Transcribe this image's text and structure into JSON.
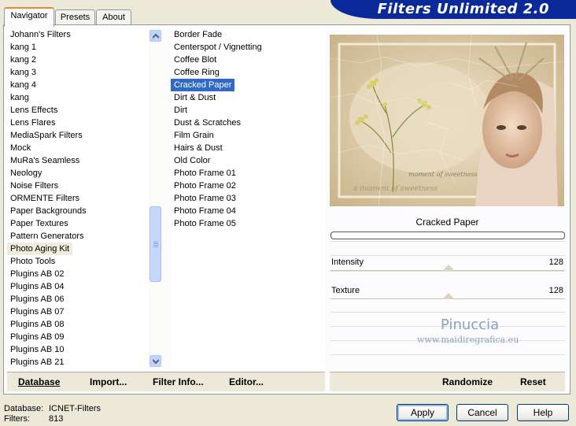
{
  "app": {
    "title": "Filters Unlimited 2.0"
  },
  "tabs": [
    {
      "label": "Navigator"
    },
    {
      "label": "Presets"
    },
    {
      "label": "About"
    }
  ],
  "categories": {
    "items": [
      "Johann's Filters",
      "kang 1",
      "kang 2",
      "kang 3",
      "kang 4",
      "kang",
      "Lens Effects",
      "Lens Flares",
      "MediaSpark Filters",
      "Mock",
      "MuRa's Seamless",
      "Neology",
      "Noise Filters",
      "ORMENTE Filters",
      "Paper Backgrounds",
      "Paper Textures",
      "Pattern Generators",
      "Photo Aging Kit",
      "Photo Tools",
      "Plugins AB 02",
      "Plugins AB 04",
      "Plugins AB 06",
      "Plugins AB 07",
      "Plugins AB 08",
      "Plugins AB 09",
      "Plugins AB 10",
      "Plugins AB 21"
    ],
    "selected": "Photo Aging Kit"
  },
  "filters": {
    "items": [
      "Border Fade",
      "Centerspot / Vignetting",
      "Coffee Blot",
      "Coffee Ring",
      "Cracked Paper",
      "Dirt & Dust",
      "Dirt",
      "Dust & Scratches",
      "Film Grain",
      "Hairs & Dust",
      "Old Color",
      "Photo Frame 01",
      "Photo Frame 02",
      "Photo Frame 03",
      "Photo Frame 04",
      "Photo Frame 05"
    ],
    "selected": "Cracked Paper"
  },
  "toolbar": {
    "database": "Database",
    "import": "Import...",
    "filter_info": "Filter Info...",
    "editor": "Editor..."
  },
  "preview": {
    "filter_name": "Cracked Paper",
    "image_text_1": "moment of sweetness",
    "image_text_2": "a moment of sweetness",
    "sliders": [
      {
        "label": "Intensity",
        "value": "128"
      },
      {
        "label": "Texture",
        "value": "128"
      }
    ],
    "randomize": "Randomize",
    "reset": "Reset",
    "watermark_name": "Pinuccia",
    "watermark_url": "www.maidiregrafica.eu"
  },
  "status": {
    "database_label": "Database:",
    "database_value": "ICNET-Filters",
    "filters_label": "Filters:",
    "filters_value": "813"
  },
  "buttons": {
    "apply": "Apply",
    "cancel": "Cancel",
    "help": "Help"
  },
  "colors": {
    "banner": "#0a2a9a",
    "selection": "#316ac5",
    "window_bg": "#ece9d8"
  }
}
